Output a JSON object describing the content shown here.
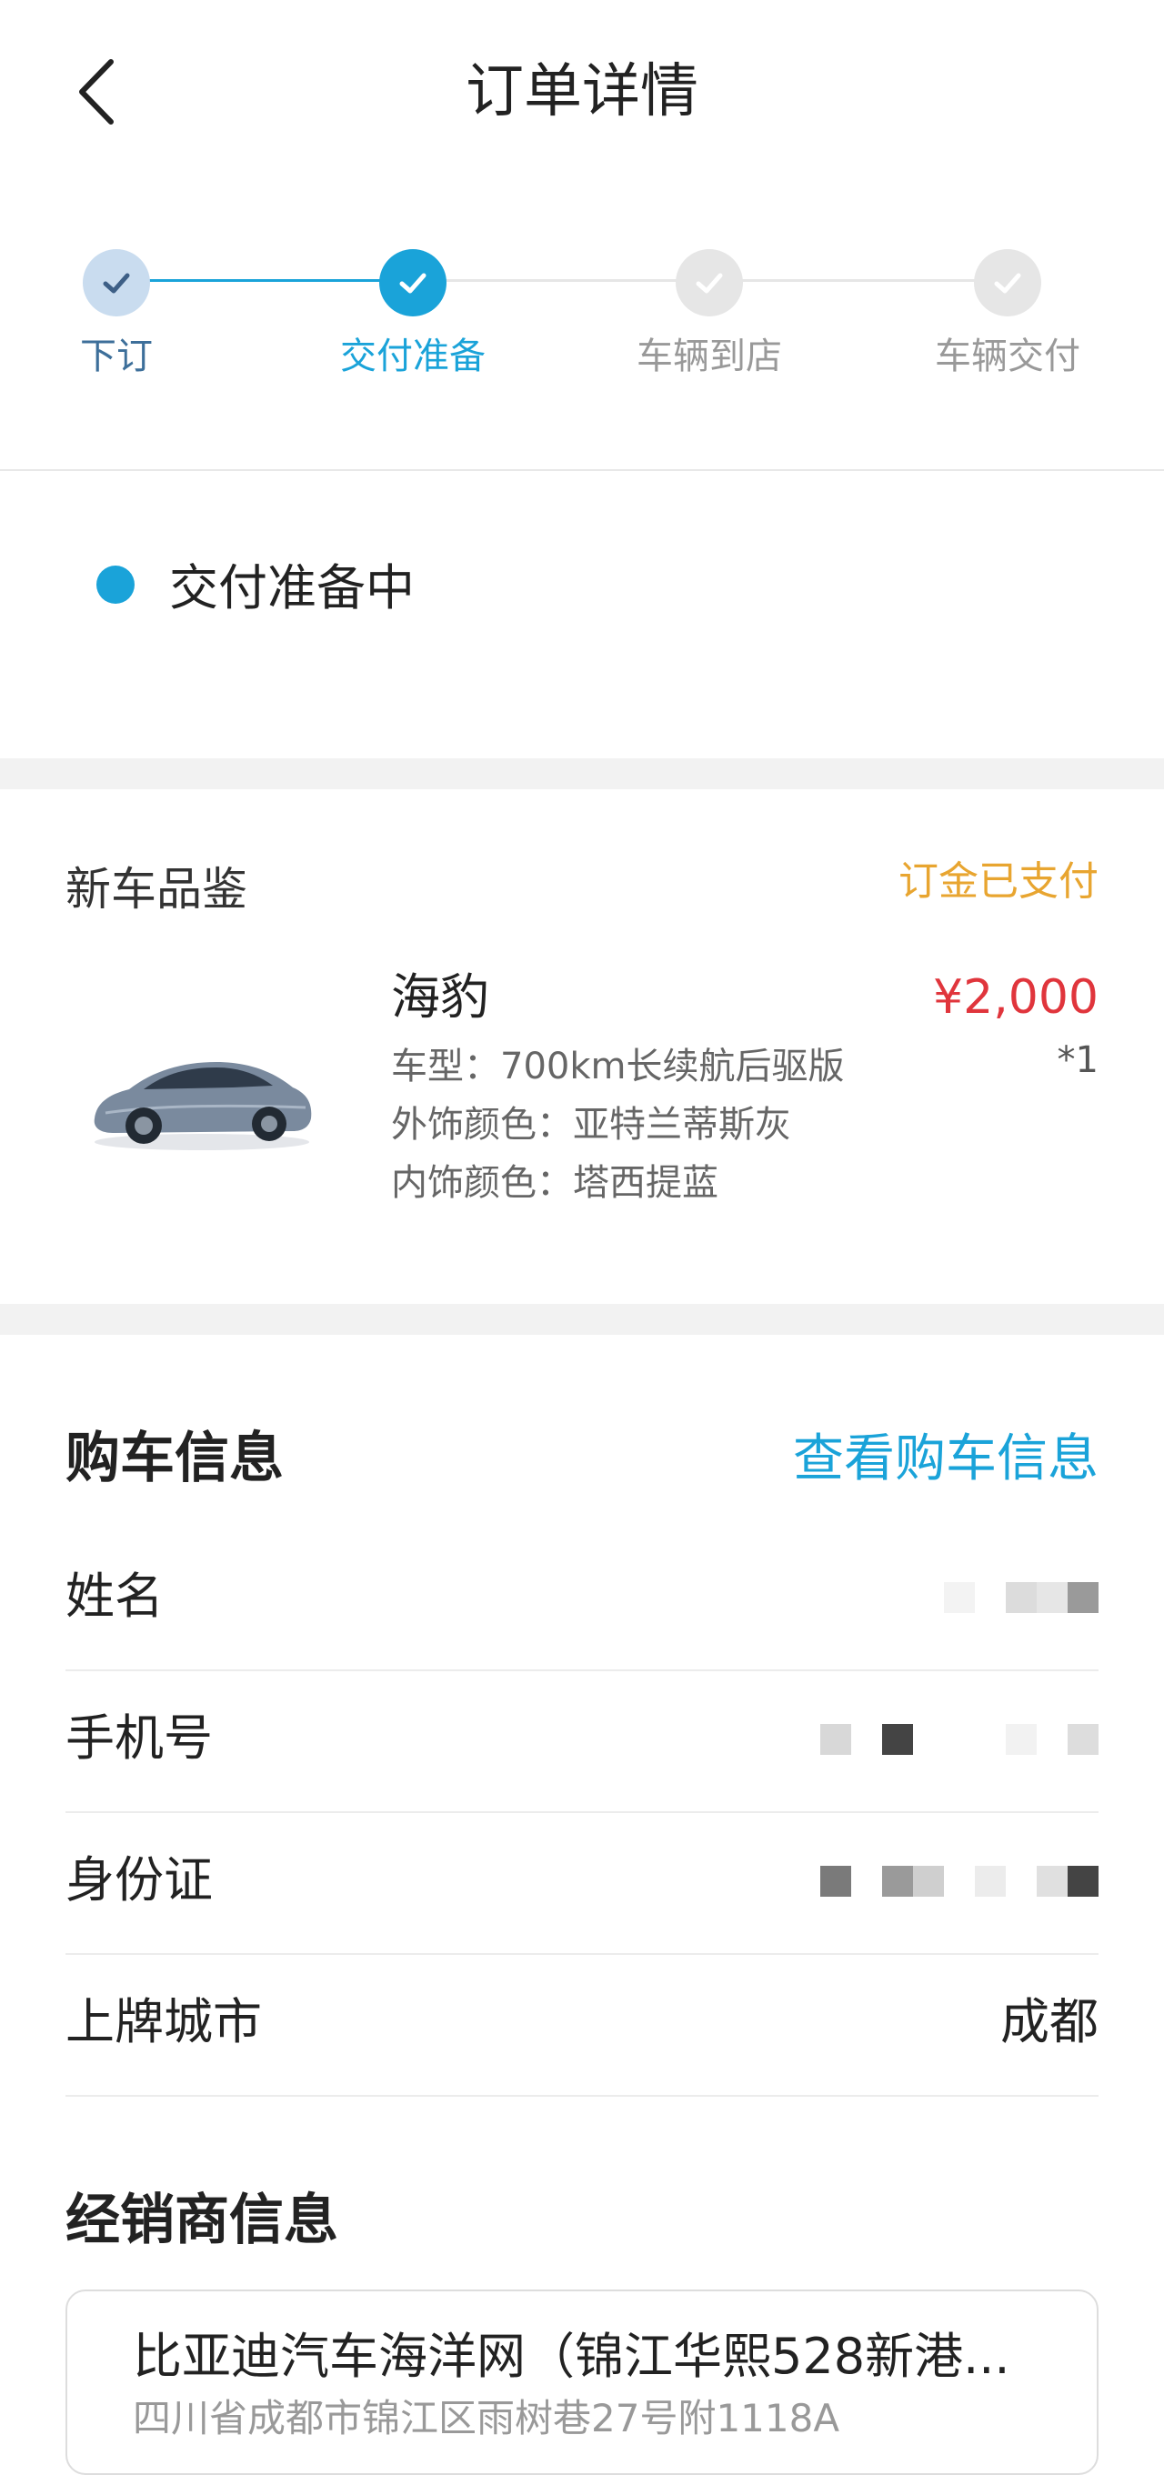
{
  "header": {
    "title": "订单详情",
    "back_icon": "chevron-left-icon"
  },
  "steps": [
    {
      "label": "下订",
      "state": "done"
    },
    {
      "label": "交付准备",
      "state": "current"
    },
    {
      "label": "车辆到店",
      "state": "pending"
    },
    {
      "label": "车辆交付",
      "state": "pending"
    }
  ],
  "status": {
    "text": "交付准备中"
  },
  "product": {
    "shop_name": "新车品鉴",
    "payment_status": "订金已支付",
    "name": "海豹",
    "price": "¥2,000",
    "quantity": "*1",
    "specs": [
      "车型：700km长续航后驱版",
      "外饰颜色：亚特兰蒂斯灰",
      "内饰颜色：塔西提蓝"
    ]
  },
  "buyer_info": {
    "title": "购车信息",
    "view_link": "查看购车信息",
    "rows": [
      {
        "label": "姓名",
        "value": ""
      },
      {
        "label": "手机号",
        "value": ""
      },
      {
        "label": "身份证",
        "value": ""
      },
      {
        "label": "上牌城市",
        "value": "成都"
      }
    ]
  },
  "dealer": {
    "title": "经销商信息",
    "name": "比亚迪汽车海洋网（锦江华熙528新港...",
    "address": "四川省成都市锦江区雨树巷27号附1118A"
  },
  "colors": {
    "accent": "#1aa3d9",
    "step_done_bg": "#c9dcef",
    "step_done_check": "#3d5f86",
    "step_done_label": "#3d6f9a",
    "step_pending": "#e6e6e6",
    "step_pending_label": "#999999",
    "pay_status": "#e8a530",
    "price": "#e0353c"
  }
}
